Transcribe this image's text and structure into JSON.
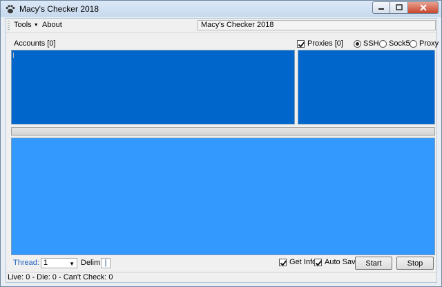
{
  "window": {
    "title": "Macy's Checker 2018",
    "icons": {
      "app": "paw-icon",
      "minimize": "minimize-icon",
      "maximize": "maximize-icon",
      "close": "close-icon"
    }
  },
  "menu": {
    "tools": "Tools",
    "about": "About",
    "title_field": "Macy's Checker 2018"
  },
  "accounts": {
    "label": "Accounts [0]"
  },
  "proxies": {
    "checkbox_label": "Proxies [0]",
    "checked": true,
    "types": [
      {
        "label": "SSH",
        "selected": true
      },
      {
        "label": "Sock5",
        "selected": false
      },
      {
        "label": "Proxy",
        "selected": false
      }
    ]
  },
  "controls": {
    "thread_label": "Thread:",
    "thread_value": "1",
    "delim_label": "Delim",
    "delim_value": "|",
    "get_info_label": "Get Info",
    "get_info_checked": true,
    "auto_save_label": "Auto Save",
    "auto_save_checked": true,
    "start_label": "Start",
    "stop_label": "Stop"
  },
  "status": {
    "text": "Live: 0 - Die: 0 - Can't Check: 0"
  },
  "colors": {
    "accounts_bg": "#0066cc",
    "proxies_bg": "#0066cc",
    "results_bg": "#3399ff",
    "thread_label": "#1f5fbf"
  }
}
